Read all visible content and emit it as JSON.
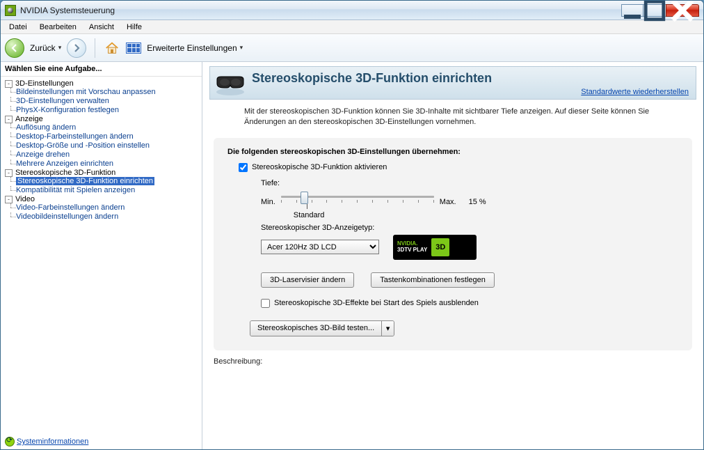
{
  "window": {
    "title": "NVIDIA Systemsteuerung"
  },
  "menu": {
    "file": "Datei",
    "edit": "Bearbeiten",
    "view": "Ansicht",
    "help": "Hilfe"
  },
  "toolbar": {
    "back": "Zurück",
    "advanced": "Erweiterte Einstellungen"
  },
  "sidebar": {
    "header": "Wählen Sie eine Aufgabe...",
    "groups": [
      {
        "label": "3D-Einstellungen",
        "items": [
          "Bildeinstellungen mit Vorschau anpassen",
          "3D-Einstellungen verwalten",
          "PhysX-Konfiguration festlegen"
        ]
      },
      {
        "label": "Anzeige",
        "items": [
          "Auflösung ändern",
          "Desktop-Farbeinstellungen ändern",
          "Desktop-Größe und -Position einstellen",
          "Anzeige drehen",
          "Mehrere Anzeigen einrichten"
        ]
      },
      {
        "label": "Stereoskopische 3D-Funktion",
        "items": [
          "Stereoskopische 3D-Funktion einrichten",
          "Kompatibilität mit Spielen anzeigen"
        ],
        "selected": 0
      },
      {
        "label": "Video",
        "items": [
          "Video-Farbeinstellungen ändern",
          "Videobildeinstellungen ändern"
        ]
      }
    ],
    "sysinfo": "Systeminformationen"
  },
  "page": {
    "title": "Stereoskopische 3D-Funktion einrichten",
    "restore": "Standardwerte wiederherstellen",
    "intro": "Mit der stereoskopischen 3D-Funktion können Sie 3D-Inhalte mit sichtbarer Tiefe anzeigen. Auf dieser Seite können Sie Änderungen an den stereoskopischen 3D-Einstellungen vornehmen.",
    "apply_header": "Die folgenden stereoskopischen 3D-Einstellungen übernehmen:",
    "enable_label": "Stereoskopische 3D-Funktion aktivieren",
    "depth_label": "Tiefe:",
    "min": "Min.",
    "max": "Max.",
    "depth_value": "15  %",
    "standard": "Standard",
    "type_label": "Stereoskopischer 3D-Anzeigetyp:",
    "type_value": "Acer 120Hz 3D LCD",
    "badge_line1": "NVIDIA.",
    "badge_line2": "3DTV PLAY",
    "badge_3d": "3D",
    "btn_laser": "3D-Laservisier ändern",
    "btn_keys": "Tastenkombinationen festlegen",
    "hide_label": "Stereoskopische 3D-Effekte bei Start des Spiels ausblenden",
    "test_label": "Stereoskopisches 3D-Bild testen...",
    "desc_label": "Beschreibung:"
  }
}
